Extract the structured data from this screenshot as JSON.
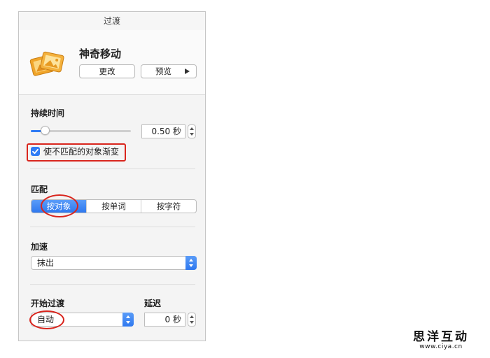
{
  "panel": {
    "title": "过渡",
    "effect_name": "神奇移动",
    "change_label": "更改",
    "preview_label": "预览",
    "duration": {
      "label": "持续时间",
      "value": "0.50 秒",
      "slider_fraction": 0.14
    },
    "fade_checkbox": {
      "label": "使不匹配的对象渐变",
      "checked": true
    },
    "match": {
      "label": "匹配",
      "options": [
        "按对象",
        "按单词",
        "按字符"
      ],
      "selected": "按对象"
    },
    "acceleration": {
      "label": "加速",
      "value": "抹出"
    },
    "start": {
      "label": "开始过渡",
      "value": "自动"
    },
    "delay": {
      "label": "延迟",
      "value": "0 秒"
    }
  },
  "watermark": {
    "main": "思洋互动",
    "sub": "www.ciya.cn"
  },
  "colors": {
    "accent": "#2f7bf5",
    "annotation": "#d9251d",
    "icon_orange": "#f0a52a"
  }
}
